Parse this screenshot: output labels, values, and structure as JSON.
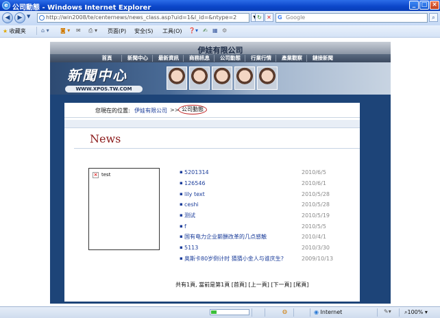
{
  "window": {
    "title": "公司動態 - Windows Internet Explorer",
    "minimize": "_",
    "maximize": "□",
    "close": "×"
  },
  "address_bar": {
    "url": "http://win2008/te/centernews/news_class.asp?uid=1&l_id=&ntype=2",
    "search_placeholder": "Google",
    "search_icon": "G"
  },
  "command_bar": {
    "favorites": "收藏夹",
    "page_menu": "页面(P)",
    "safety_menu": "安全(S)",
    "tools_menu": "工具(O)"
  },
  "site": {
    "company": "伊娃有限公司",
    "nav": [
      "首頁",
      "新聞中心",
      "最新資訊",
      "商務訊息",
      "公司動態",
      "行業行情",
      "產業觀察",
      "鏈接新聞"
    ],
    "banner_logo": "新聞中心",
    "banner_url": "WWW.XPOS.TW.COM"
  },
  "breadcrumb": {
    "label": "您現在的位置:",
    "link": "伊娃有限公司",
    "separator": ">>",
    "current": "公司動態"
  },
  "news": {
    "heading": "News",
    "image_alt": "test",
    "items": [
      {
        "title": "5201314",
        "date": "2010/6/5"
      },
      {
        "title": "126546",
        "date": "2010/6/1"
      },
      {
        "title": "lily text",
        "date": "2010/5/28"
      },
      {
        "title": "ceshi",
        "date": "2010/5/28"
      },
      {
        "title": "测试",
        "date": "2010/5/19"
      },
      {
        "title": "f",
        "date": "2010/5/5"
      },
      {
        "title": "国有电力企业薪酬改革的几点感触",
        "date": "2010/4/1"
      },
      {
        "title": "5113",
        "date": "2010/3/30"
      },
      {
        "title": "奥斯卡80岁倒计时 猜猜小金人与谁庆生?",
        "date": "2009/10/13"
      }
    ],
    "pager": "共有1頁, 當前是第1頁 [首頁] [上一頁] [下一頁] [尾頁]"
  },
  "status_bar": {
    "zone": "Internet",
    "zoom": "100%",
    "progress": 0.15
  }
}
